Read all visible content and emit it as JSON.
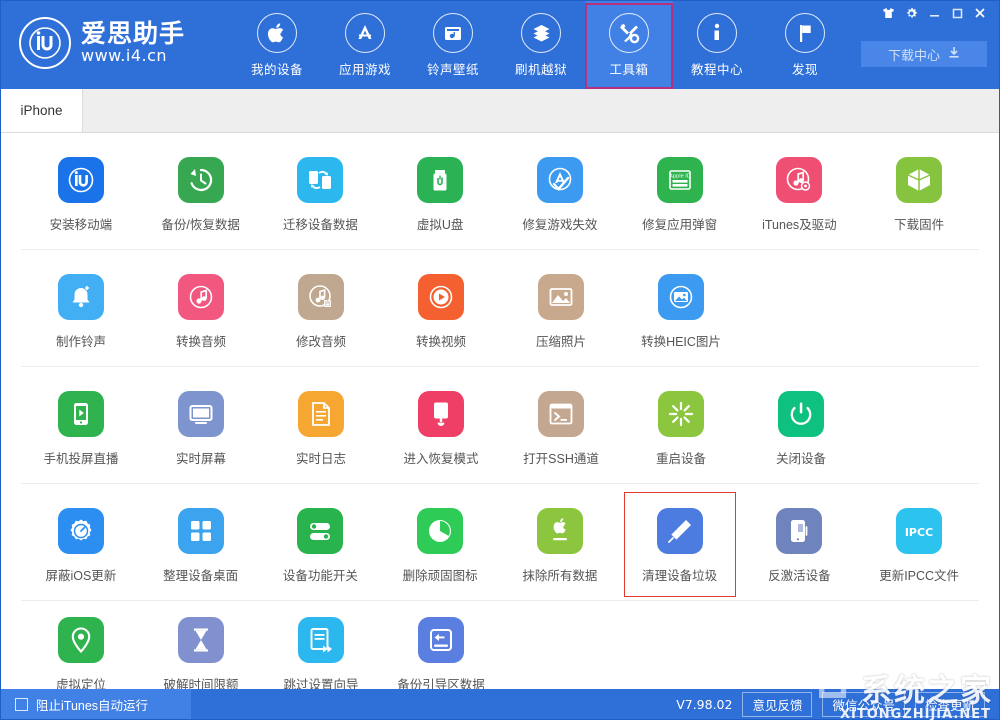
{
  "window": {
    "controls": [
      {
        "name": "skin-icon",
        "glyph": "shirt"
      },
      {
        "name": "settings-icon",
        "glyph": "gear"
      },
      {
        "name": "minimize-icon",
        "glyph": "minimize"
      },
      {
        "name": "maximize-icon",
        "glyph": "maximize"
      },
      {
        "name": "close-icon",
        "glyph": "close"
      }
    ]
  },
  "brand": {
    "logo_text": "iU",
    "name": "爱思助手",
    "url": "www.i4.cn"
  },
  "header": {
    "nav": [
      {
        "label": "我的设备",
        "icon": "apple-icon",
        "active": false,
        "highlight": false
      },
      {
        "label": "应用游戏",
        "icon": "appstore-icon",
        "active": false,
        "highlight": false
      },
      {
        "label": "铃声壁纸",
        "icon": "ringtone-wallpaper-icon",
        "active": false,
        "highlight": false
      },
      {
        "label": "刷机越狱",
        "icon": "flash-jailbreak-icon",
        "active": false,
        "highlight": false
      },
      {
        "label": "工具箱",
        "icon": "toolbox-icon",
        "active": true,
        "highlight": true
      },
      {
        "label": "教程中心",
        "icon": "info-icon",
        "active": false,
        "highlight": false
      },
      {
        "label": "发现",
        "icon": "flag-icon",
        "active": false,
        "highlight": false
      }
    ],
    "download_center": {
      "label": "下载中心",
      "icon": "download-icon"
    }
  },
  "tabs": [
    {
      "label": "iPhone",
      "active": true
    }
  ],
  "accent": {
    "header_blue": "#2f6fd8",
    "nav_active_blue": "#4180e4",
    "nav_highlight_border": "#b5307f",
    "tile_highlight_border": "#e03a2f"
  },
  "tool_rows": [
    {
      "tools": [
        {
          "label": "安装移动端",
          "icon": "install-mobile-icon",
          "bg": "#1a73e8",
          "marked": false
        },
        {
          "label": "备份/恢复数据",
          "icon": "backup-restore-icon",
          "bg": "#37a752",
          "marked": false
        },
        {
          "label": "迁移设备数据",
          "icon": "migrate-data-icon",
          "bg": "#2cb8ef",
          "marked": false
        },
        {
          "label": "虚拟U盘",
          "icon": "virtual-udisk-icon",
          "bg": "#2bb255",
          "marked": false
        },
        {
          "label": "修复游戏失效",
          "icon": "fix-game-icon",
          "bg": "#3c9bf0",
          "marked": false
        },
        {
          "label": "修复应用弹窗",
          "icon": "fix-popup-icon",
          "bg": "#2fb34f",
          "marked": false
        },
        {
          "label": "iTunes及驱动",
          "icon": "itunes-driver-icon",
          "bg": "#ef4f73",
          "marked": false
        },
        {
          "label": "下载固件",
          "icon": "download-firmware-icon",
          "bg": "#86c440",
          "marked": false
        }
      ]
    },
    {
      "tools": [
        {
          "label": "制作铃声",
          "icon": "make-ringtone-icon",
          "bg": "#42aef3",
          "marked": false
        },
        {
          "label": "转换音频",
          "icon": "convert-audio-icon",
          "bg": "#f2577f",
          "marked": false
        },
        {
          "label": "修改音频",
          "icon": "edit-audio-icon",
          "bg": "#bfa88f",
          "marked": false
        },
        {
          "label": "转换视频",
          "icon": "convert-video-icon",
          "bg": "#f4602f",
          "marked": false
        },
        {
          "label": "压缩照片",
          "icon": "compress-photo-icon",
          "bg": "#c9a98d",
          "marked": false
        },
        {
          "label": "转换HEIC图片",
          "icon": "convert-heic-icon",
          "bg": "#3c9bf0",
          "marked": false
        }
      ]
    },
    {
      "tools": [
        {
          "label": "手机投屏直播",
          "icon": "screen-cast-icon",
          "bg": "#2fb34f",
          "marked": false
        },
        {
          "label": "实时屏幕",
          "icon": "live-screen-icon",
          "bg": "#7d94cf",
          "marked": false
        },
        {
          "label": "实时日志",
          "icon": "live-log-icon",
          "bg": "#f5a731",
          "marked": false
        },
        {
          "label": "进入恢复模式",
          "icon": "recovery-mode-icon",
          "bg": "#ef3f66",
          "marked": false
        },
        {
          "label": "打开SSH通道",
          "icon": "ssh-tunnel-icon",
          "bg": "#c3a791",
          "marked": false
        },
        {
          "label": "重启设备",
          "icon": "reboot-device-icon",
          "bg": "#8cc63e",
          "marked": false
        },
        {
          "label": "关闭设备",
          "icon": "shutdown-device-icon",
          "bg": "#0ec17e",
          "marked": false
        }
      ]
    },
    {
      "tools": [
        {
          "label": "屏蔽iOS更新",
          "icon": "block-ios-update-icon",
          "bg": "#2b8ef0",
          "marked": false
        },
        {
          "label": "整理设备桌面",
          "icon": "organize-desktop-icon",
          "bg": "#3ca4ef",
          "marked": false
        },
        {
          "label": "设备功能开关",
          "icon": "feature-toggle-icon",
          "bg": "#29b34c",
          "marked": false
        },
        {
          "label": "删除顽固图标",
          "icon": "delete-stubborn-icon",
          "bg": "#2ecc57",
          "marked": false
        },
        {
          "label": "抹除所有数据",
          "icon": "erase-all-data-icon",
          "bg": "#8cc63e",
          "marked": false
        },
        {
          "label": "清理设备垃圾",
          "icon": "clean-junk-icon",
          "bg": "#4c7ce0",
          "marked": true
        },
        {
          "label": "反激活设备",
          "icon": "deactivate-device-icon",
          "bg": "#6f83bd",
          "marked": false
        },
        {
          "label": "更新IPCC文件",
          "icon": "update-ipcc-icon",
          "bg": "#2cc3ef",
          "marked": false
        }
      ]
    },
    {
      "tools": [
        {
          "label": "虚拟定位",
          "icon": "virtual-location-icon",
          "bg": "#2fb34f",
          "marked": false
        },
        {
          "label": "破解时间限额",
          "icon": "crack-time-limit-icon",
          "bg": "#8190cf",
          "marked": false
        },
        {
          "label": "跳过设置向导",
          "icon": "skip-setup-icon",
          "bg": "#2cb8ef",
          "marked": false
        },
        {
          "label": "备份引导区数据",
          "icon": "backup-boot-icon",
          "bg": "#5b7fe0",
          "marked": false
        }
      ]
    }
  ],
  "footer": {
    "block_itunes_label": "阻止iTunes自动运行",
    "checkbox_checked": false,
    "version": "V7.98.02",
    "buttons": [
      {
        "label": "意见反馈"
      },
      {
        "label": "微信公众号"
      },
      {
        "label": "检查更新"
      }
    ]
  },
  "watermark": {
    "main": "系统之家",
    "sub": "XITONGZHIJIA.NET"
  }
}
